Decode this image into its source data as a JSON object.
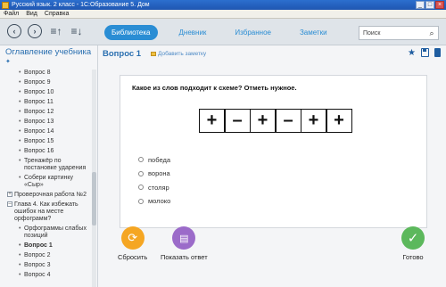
{
  "window": {
    "title": "Русский язык. 2 класс - 1С:Образование 5. Дом"
  },
  "menubar": {
    "items": [
      "Файл",
      "Вид",
      "Справка"
    ]
  },
  "toolbar": {
    "tabs": [
      {
        "label": "Библиотека",
        "active": true
      },
      {
        "label": "Дневник",
        "active": false
      },
      {
        "label": "Избранное",
        "active": false
      },
      {
        "label": "Заметки",
        "active": false
      }
    ],
    "search": {
      "placeholder": "Поиск"
    }
  },
  "sidebar": {
    "title": "Оглавление учебника",
    "items": [
      {
        "label": "Вопрос 8",
        "level": 1
      },
      {
        "label": "Вопрос 9",
        "level": 1
      },
      {
        "label": "Вопрос 10",
        "level": 1
      },
      {
        "label": "Вопрос 11",
        "level": 1
      },
      {
        "label": "Вопрос 12",
        "level": 1
      },
      {
        "label": "Вопрос 13",
        "level": 1
      },
      {
        "label": "Вопрос 14",
        "level": 1
      },
      {
        "label": "Вопрос 15",
        "level": 1
      },
      {
        "label": "Вопрос 16",
        "level": 1
      },
      {
        "label": "Тренажёр по постановке ударения",
        "level": 1
      },
      {
        "label": "Собери картинку «Сыр»",
        "level": 1
      },
      {
        "label": "Проверочная работа №2",
        "level": 0
      },
      {
        "label": "Глава 4. Как избежать ошибок на месте орфограмм?",
        "level": 0
      },
      {
        "label": "Орфограммы слабых позиций",
        "level": 1
      },
      {
        "label": "Вопрос 1",
        "level": 1,
        "active": true
      },
      {
        "label": "Вопрос 2",
        "level": 1
      },
      {
        "label": "Вопрос 3",
        "level": 1
      },
      {
        "label": "Вопрос 4",
        "level": 1
      }
    ]
  },
  "main": {
    "title": "Вопрос 1",
    "add_note": "Добавить заметку",
    "question": "Какое из слов подходит к схеме? Отметь нужное.",
    "scheme": [
      "+",
      "–",
      "+",
      "–",
      "+",
      "+"
    ],
    "options": [
      "победа",
      "ворона",
      "столяр",
      "молоко"
    ],
    "actions": {
      "reset": "Сбросить",
      "show": "Показать ответ",
      "done": "Готово"
    }
  }
}
